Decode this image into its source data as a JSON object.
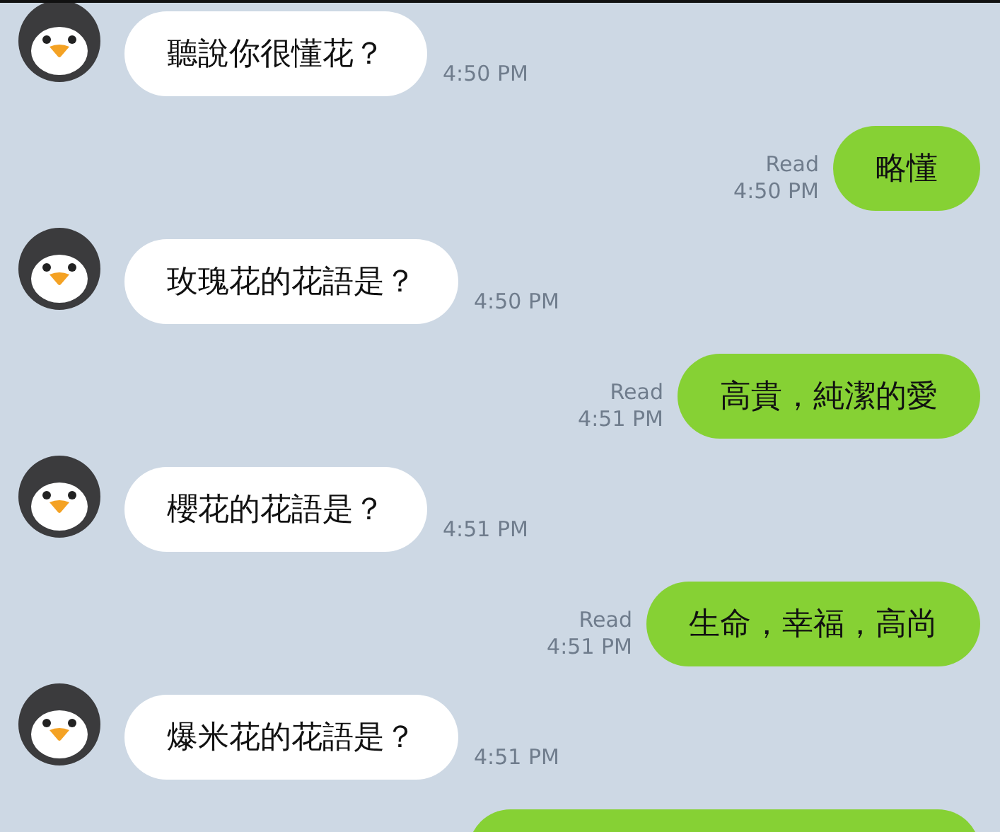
{
  "messages": [
    {
      "kind": "incoming",
      "text": "聽說你很懂花？",
      "time": "4:50 PM"
    },
    {
      "kind": "outgoing",
      "text": "略懂",
      "read": "Read",
      "time": "4:50 PM"
    },
    {
      "kind": "incoming",
      "text": "玫瑰花的花語是？",
      "time": "4:50 PM"
    },
    {
      "kind": "outgoing",
      "text": "高貴，純潔的愛",
      "read": "Read",
      "time": "4:51 PM"
    },
    {
      "kind": "incoming",
      "text": "櫻花的花語是？",
      "time": "4:51 PM"
    },
    {
      "kind": "outgoing",
      "text": "生命，幸福，高尚",
      "read": "Read",
      "time": "4:51 PM"
    },
    {
      "kind": "incoming",
      "text": "爆米花的花語是？",
      "time": "4:51 PM"
    },
    {
      "kind": "outgoing"
    }
  ]
}
